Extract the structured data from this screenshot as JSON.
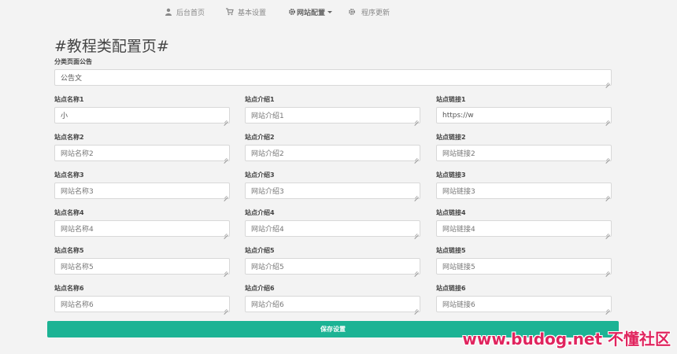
{
  "nav": {
    "items": [
      {
        "label": "后台首页",
        "icon": "user-icon"
      },
      {
        "label": "基本设置",
        "icon": "cart-icon"
      },
      {
        "label": "网站配置",
        "icon": "gear-icon"
      },
      {
        "label": "程序更新",
        "icon": "gear-icon"
      }
    ]
  },
  "page_title": "#教程类配置页#",
  "announcement": {
    "label": "分类页面公告",
    "value": "公告文"
  },
  "rows": [
    {
      "name": {
        "label": "站点名称1",
        "value": "小",
        "placeholder": "网站名称1"
      },
      "intro": {
        "label": "站点介绍1",
        "value": "",
        "placeholder": "网站介绍1"
      },
      "link": {
        "label": "站点链接1",
        "value": "https://w",
        "placeholder": "网站链接1"
      }
    },
    {
      "name": {
        "label": "站点名称2",
        "value": "",
        "placeholder": "网站名称2"
      },
      "intro": {
        "label": "站点介绍2",
        "value": "",
        "placeholder": "网站介绍2"
      },
      "link": {
        "label": "站点链接2",
        "value": "",
        "placeholder": "网站链接2"
      }
    },
    {
      "name": {
        "label": "站点名称3",
        "value": "",
        "placeholder": "网站名称3"
      },
      "intro": {
        "label": "站点介绍3",
        "value": "",
        "placeholder": "网站介绍3"
      },
      "link": {
        "label": "站点链接3",
        "value": "",
        "placeholder": "网站链接3"
      }
    },
    {
      "name": {
        "label": "站点名称4",
        "value": "",
        "placeholder": "网站名称4"
      },
      "intro": {
        "label": "站点介绍4",
        "value": "",
        "placeholder": "网站介绍4"
      },
      "link": {
        "label": "站点链接4",
        "value": "",
        "placeholder": "网站链接4"
      }
    },
    {
      "name": {
        "label": "站点名称5",
        "value": "",
        "placeholder": "网站名称5"
      },
      "intro": {
        "label": "站点介绍5",
        "value": "",
        "placeholder": "网站介绍5"
      },
      "link": {
        "label": "站点链接5",
        "value": "",
        "placeholder": "网站链接5"
      }
    },
    {
      "name": {
        "label": "站点名称6",
        "value": "",
        "placeholder": "网站名称6"
      },
      "intro": {
        "label": "站点介绍6",
        "value": "",
        "placeholder": "网站介绍6"
      },
      "link": {
        "label": "站点链接6",
        "value": "",
        "placeholder": "网站链接6"
      }
    }
  ],
  "save_label": "保存设置",
  "watermark": "www.budog.net 不懂社区",
  "colors": {
    "accent": "#1cb394",
    "watermark": "#e0245e"
  }
}
